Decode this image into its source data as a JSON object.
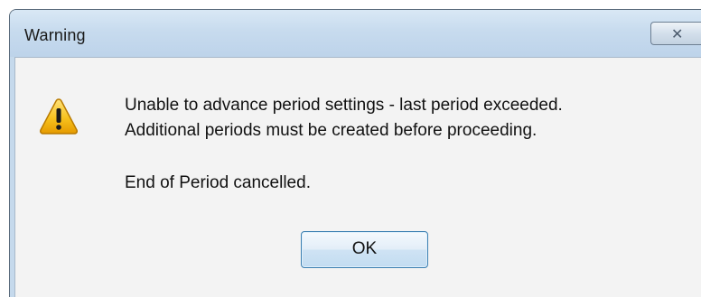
{
  "dialog": {
    "title": "Warning",
    "close_icon": "close-icon",
    "icon": "warning-icon",
    "message_line1": "Unable to advance period settings - last period exceeded.",
    "message_line2": "Additional periods must be created before proceeding.",
    "message_line3": "End of Period cancelled.",
    "ok_label": "OK"
  },
  "colors": {
    "titlebar": "#c7dbee",
    "client_background": "#f3f3f3",
    "ok_border": "#3c7fb1",
    "warning_fill": "#f5b800"
  }
}
